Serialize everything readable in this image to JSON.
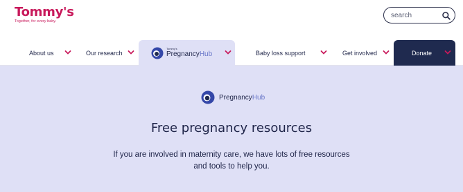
{
  "header": {
    "logo": {
      "word": "Tommy's",
      "tagline": "Together, for every baby."
    },
    "search": {
      "placeholder": "search"
    }
  },
  "nav": {
    "items": [
      {
        "label": "About us"
      },
      {
        "label": "Our research"
      },
      {
        "hub_top": "Tommy's",
        "hub_main": "Pregnancy",
        "hub_accent": "Hub"
      },
      {
        "label": "Baby loss support"
      },
      {
        "label": "Get involved"
      },
      {
        "label": "Donate"
      }
    ]
  },
  "hero": {
    "logo_main": "Pregnancy",
    "logo_accent": "Hub",
    "title": "Free pregnancy resources",
    "subtitle_line1": "If you are involved in maternity care, we have lots of free resources",
    "subtitle_line2": "and tools to help you."
  },
  "colors": {
    "brand": "#c8195b",
    "navy": "#1f2a4f",
    "hero_bg": "#dfe0f6",
    "accent": "#6a78c9"
  },
  "icons": {
    "search": "search-icon",
    "chevron": "chevron-down-icon",
    "hub": "pregnancy-hub-icon"
  }
}
